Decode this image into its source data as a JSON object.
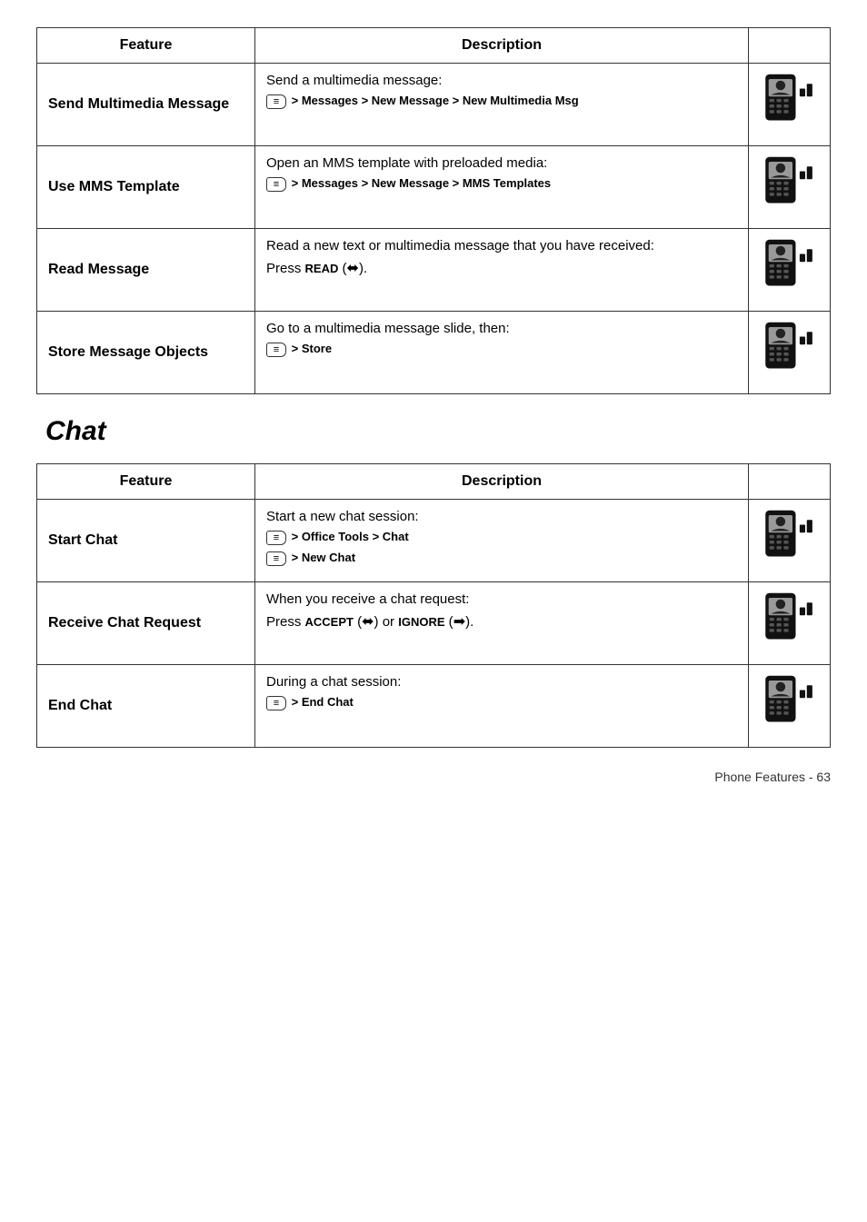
{
  "tables": [
    {
      "headers": [
        "Feature",
        "Description",
        ""
      ],
      "rows": [
        {
          "feature": "Send Multimedia Message",
          "description_lines": [
            "Send a multimedia message:",
            "menu > Messages > New Message > New Multimedia Msg"
          ],
          "has_menu_path": true,
          "menu_text": " > Messages > New Message > New Multimedia Msg"
        },
        {
          "feature": "Use MMS Template",
          "description_lines": [
            "Open an MMS template with preloaded media:",
            "menu > Messages > New Message > MMS Templates"
          ],
          "has_menu_path": true,
          "menu_text": " > Messages > New Message > MMS Templates"
        },
        {
          "feature": "Read Message",
          "description_lines": [
            "Read a new text or multimedia message that you have received:",
            "Press READ (softkey)."
          ],
          "has_menu_path": false,
          "menu_text": ""
        },
        {
          "feature": "Store Message Objects",
          "description_lines": [
            "Go to a multimedia message slide, then:",
            "menu > Store"
          ],
          "has_menu_path": true,
          "menu_text": " > Store"
        }
      ]
    },
    {
      "headers": [
        "Feature",
        "Description",
        ""
      ],
      "rows": [
        {
          "feature": "Start Chat",
          "description_lines": [
            "Start a new chat session:",
            "menu > Office Tools > Chat",
            "menu > New Chat"
          ],
          "has_menu_path": true,
          "menu_text1": " > Office Tools > Chat",
          "menu_text2": " > New Chat"
        },
        {
          "feature": "Receive Chat Request",
          "description_lines": [
            "When you receive a chat request:",
            "Press ACCEPT (softkey) or IGNORE (softkey)."
          ],
          "has_menu_path": false,
          "menu_text": ""
        },
        {
          "feature": "End Chat",
          "description_lines": [
            "During a chat session:",
            "menu > End Chat"
          ],
          "has_menu_path": true,
          "menu_text": " > End Chat"
        }
      ]
    }
  ],
  "chat_heading": "Chat",
  "footer": {
    "text": "Phone Features - 63"
  }
}
